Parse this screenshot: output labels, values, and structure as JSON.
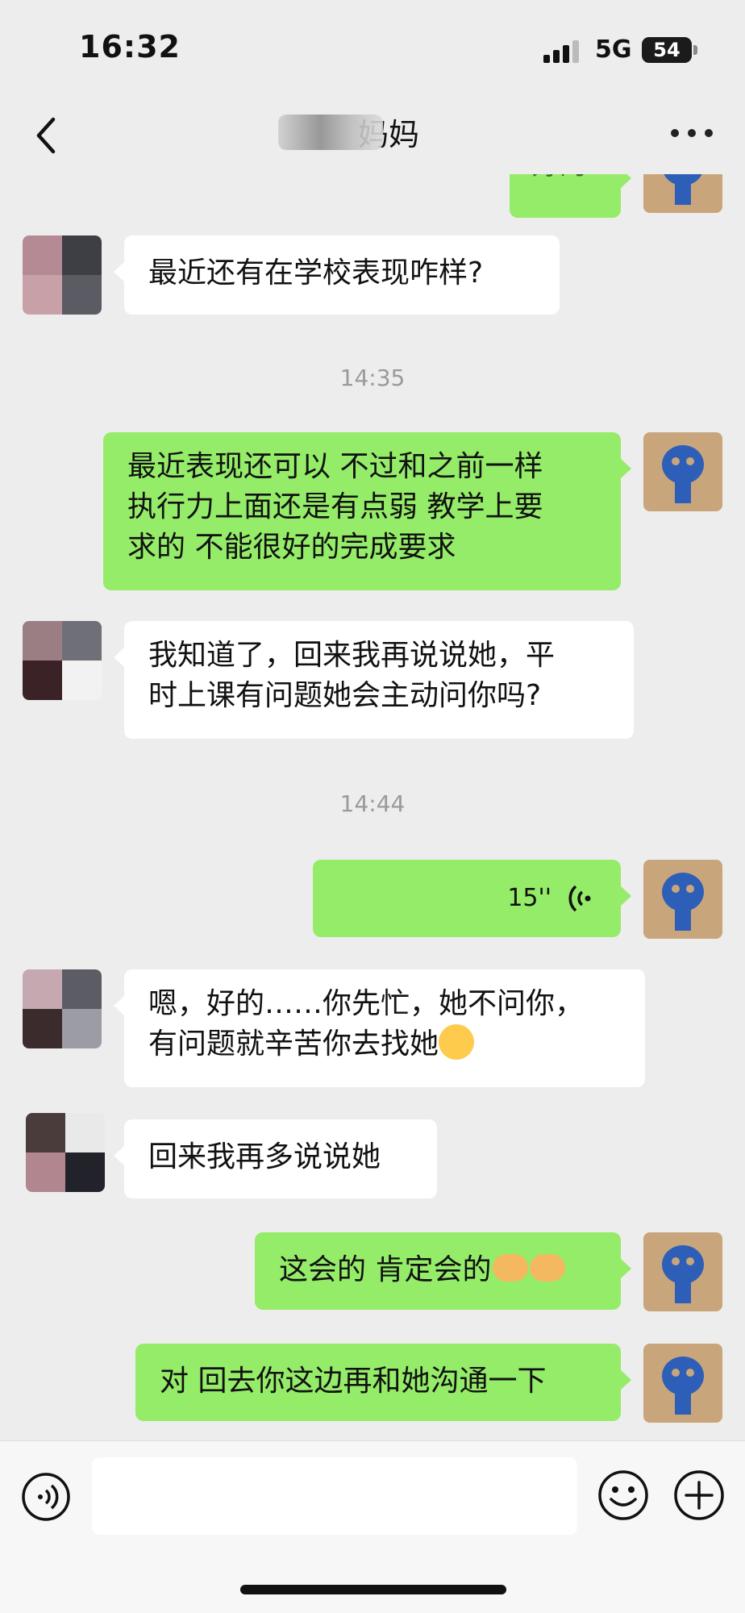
{
  "status_bar": {
    "time": "16:32",
    "network": "5G",
    "battery": "54"
  },
  "nav": {
    "title": "妈妈",
    "back_icon": "chevron-left-icon",
    "more_icon": "more-dots-icon"
  },
  "messages": [
    {
      "type": "out",
      "text": "好的"
    },
    {
      "type": "in",
      "text": "最近还有在学校表现咋样?"
    },
    {
      "type": "time",
      "text": "14:35"
    },
    {
      "type": "out",
      "text": "最近表现还可以 不过和之前一样\n执行力上面还是有点弱 教学上要\n求的 不能很好的完成要求"
    },
    {
      "type": "in",
      "text": "我知道了，回来我再说说她，平\n时上课有问题她会主动问你吗?"
    },
    {
      "type": "time",
      "text": "14:44"
    },
    {
      "type": "voice",
      "duration": "15''"
    },
    {
      "type": "in",
      "text": "嗯，好的……你先忙，她不问你，\n有问题就辛苦你去找她"
    },
    {
      "type": "in",
      "text": "回来我再多说说她"
    },
    {
      "type": "out",
      "text": "这会的 肯定会的"
    },
    {
      "type": "out",
      "text": "对 回去你这边再和她沟通一下"
    }
  ],
  "input_bar": {
    "voice_icon": "voice-icon",
    "emoji_icon": "smiley-icon",
    "plus_icon": "plus-icon"
  }
}
